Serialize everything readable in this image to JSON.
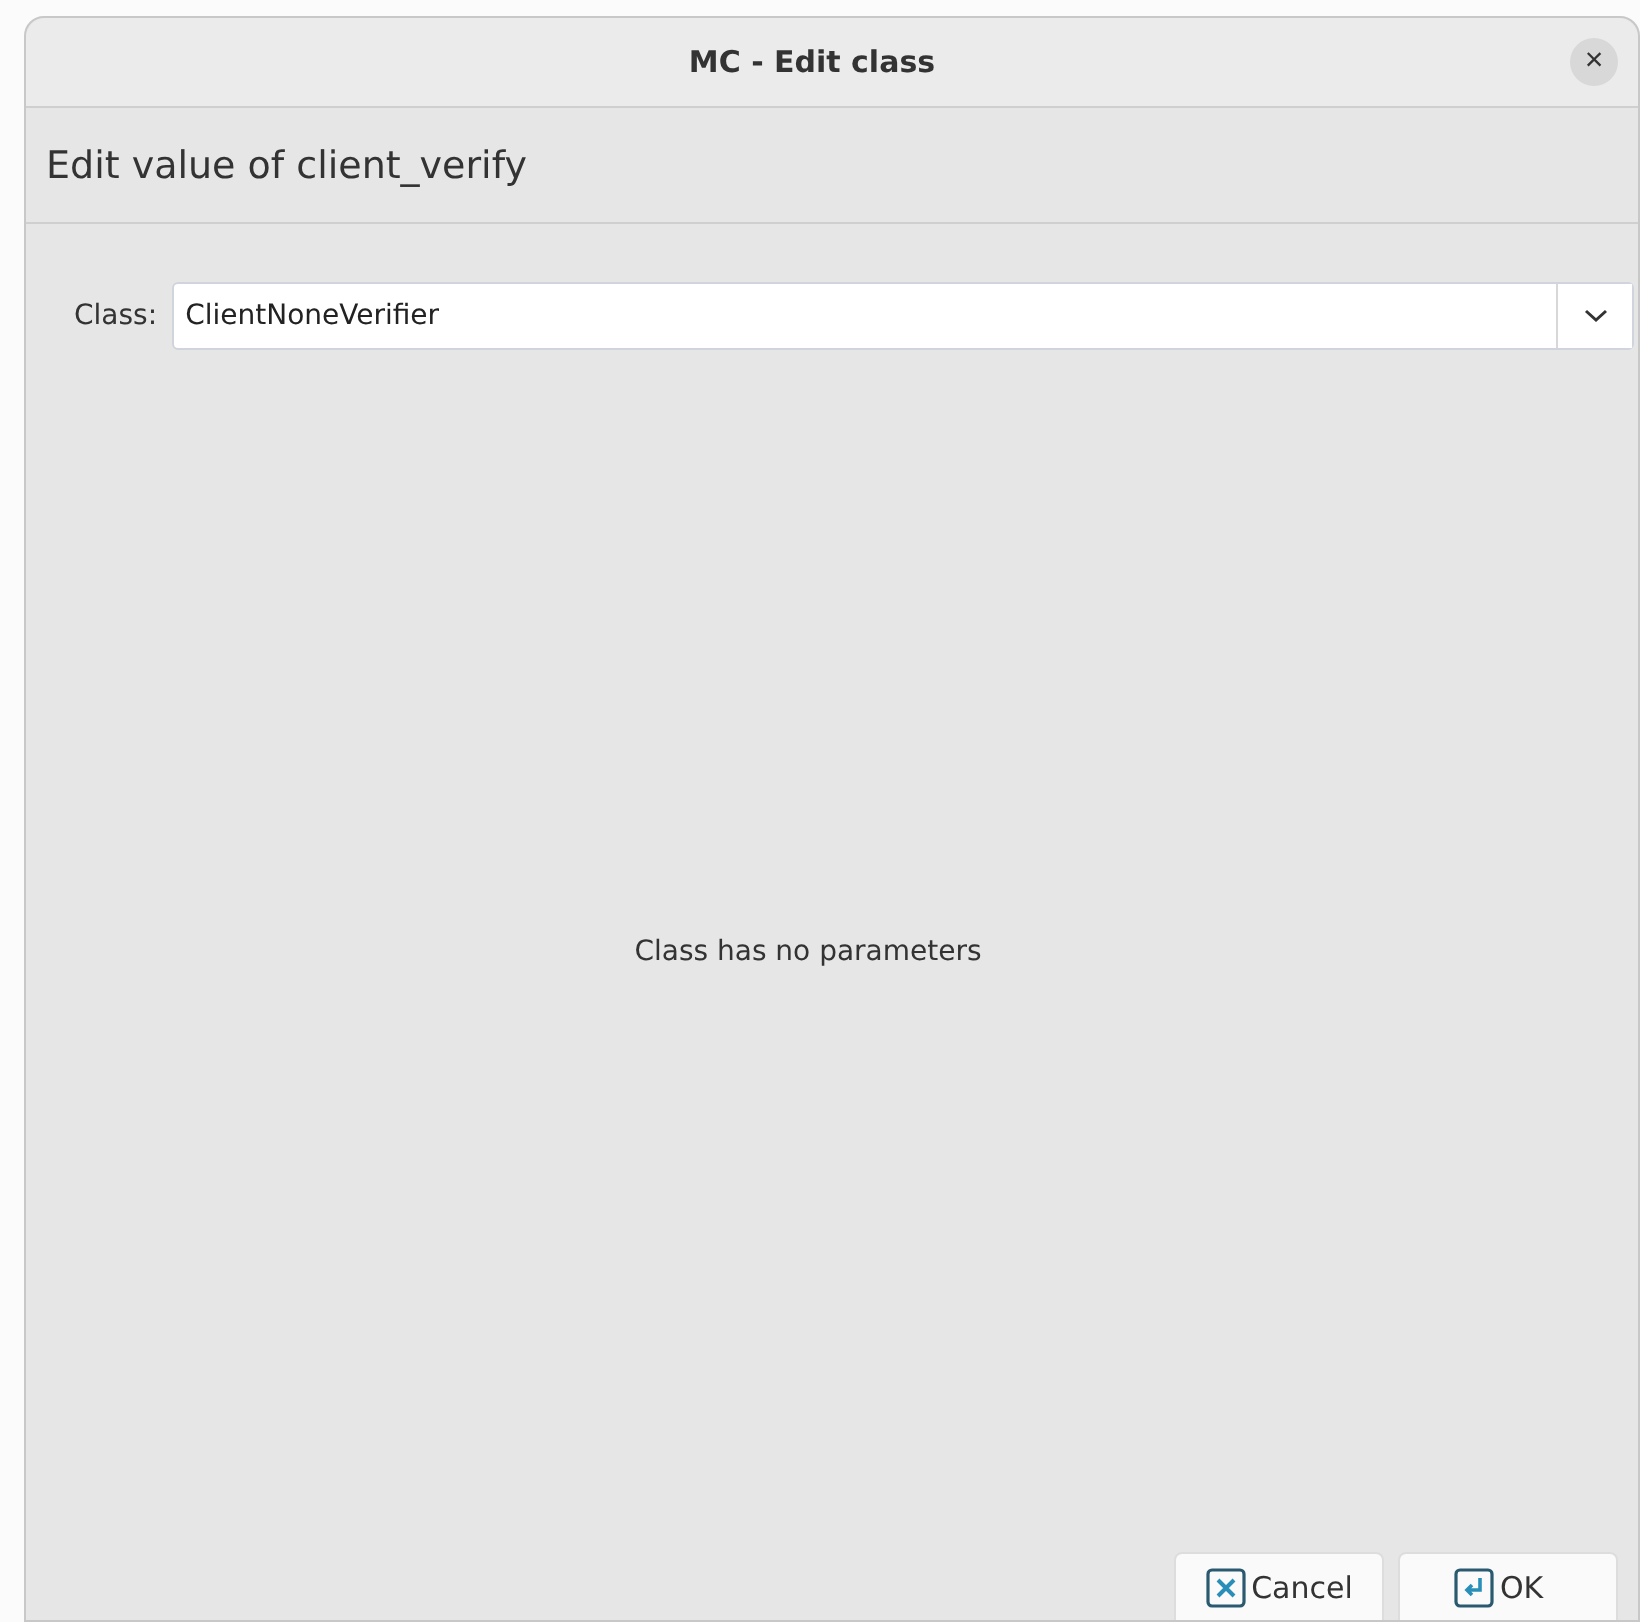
{
  "window": {
    "title": "MC - Edit class",
    "close": "×"
  },
  "header": "Edit value of client_verify",
  "class_field": {
    "label": "Class:",
    "value": "ClientNoneVerifier"
  },
  "message": "Class has no parameters",
  "buttons": [
    {
      "label": "Cancel",
      "kind": "cancel"
    },
    {
      "label": "OK",
      "kind": "ok"
    }
  ]
}
